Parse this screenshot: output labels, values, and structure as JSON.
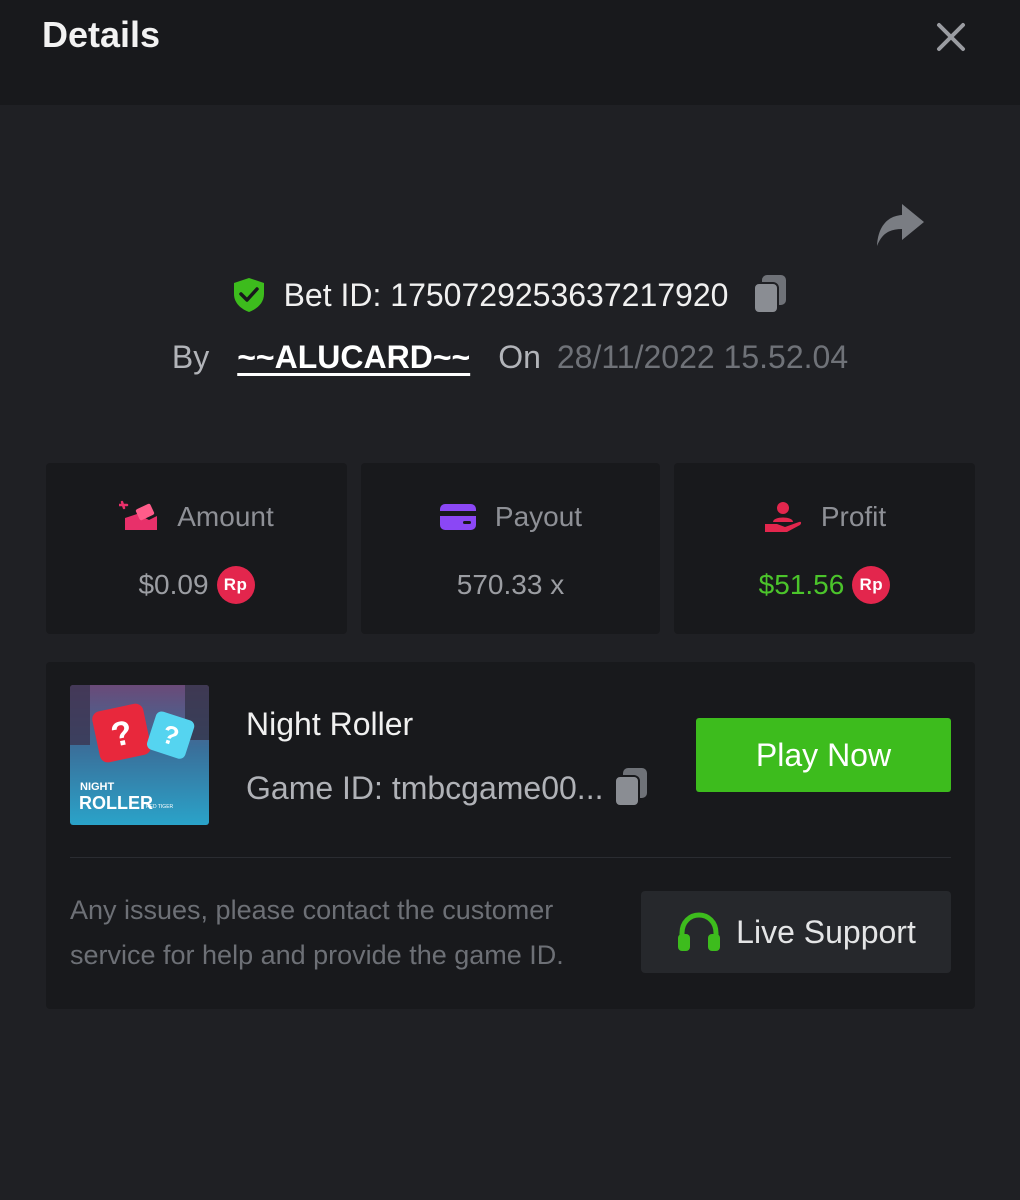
{
  "header": {
    "title": "Details",
    "close_icon": "close-icon"
  },
  "share_icon": "share-icon",
  "bet": {
    "id_text": "Bet ID: 1750729253637217920",
    "by_label": "By",
    "username": "~~ALUCARD~~",
    "on_label": "On",
    "date": "28/11/2022 15.52.04"
  },
  "stats": [
    {
      "label": "Amount",
      "value": "$0.09",
      "currency": "Rp",
      "icon": "coins-icon"
    },
    {
      "label": "Payout",
      "value": "570.33 x",
      "icon": "card-icon"
    },
    {
      "label": "Profit",
      "value": "$51.56",
      "currency": "Rp",
      "icon": "hand-user-icon"
    }
  ],
  "game": {
    "thumb_line1": "NIGHT",
    "thumb_line2": "ROLLER",
    "thumb_brand": "RED TIGER",
    "name": "Night Roller",
    "id_text": "Game ID: tmbcgame00...",
    "play_label": "Play Now"
  },
  "support": {
    "note": "Any issues, please contact the customer service for help and provide the game ID.",
    "button_label": "Live Support"
  },
  "colors": {
    "background": "#1f2024",
    "panel": "#18191c",
    "accent_green": "#3dbc1d",
    "profit_green": "#4bc42b",
    "currency_badge": "#e3264d"
  }
}
